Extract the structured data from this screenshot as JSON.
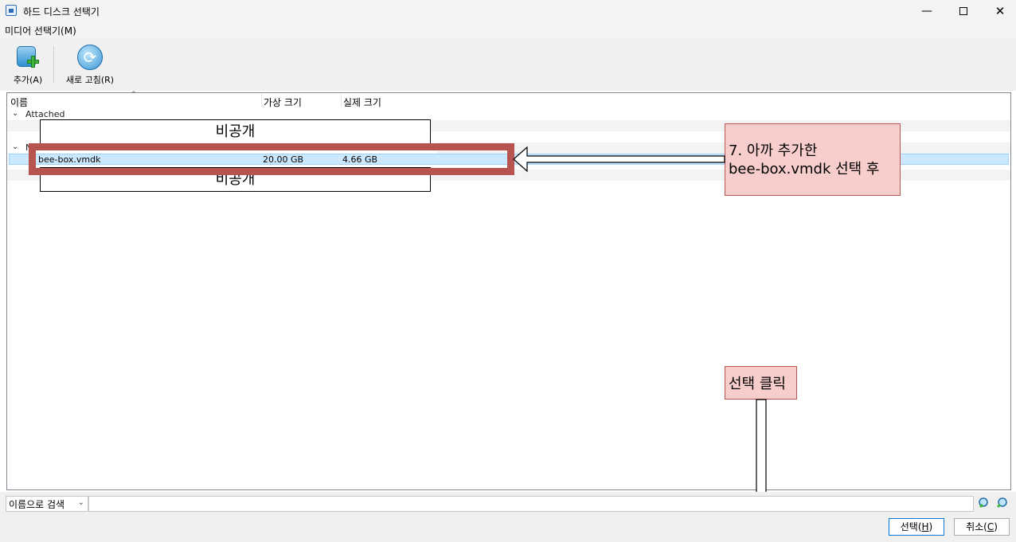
{
  "window": {
    "title": "하드 디스크 선택기",
    "controls": {
      "minimize": "—",
      "close": "✕"
    }
  },
  "menubar": {
    "media_menu": "미디어 선택기(M)"
  },
  "toolbar": {
    "add_label": "추가(A)",
    "refresh_label": "새로 고침(R)"
  },
  "list": {
    "columns": {
      "name": "이름",
      "virtual_size": "가상 크기",
      "actual_size": "실제 크기",
      "sort_indicator": "^"
    },
    "groups": [
      {
        "chevron": "⌄",
        "label": "Attached"
      },
      {
        "chevron": "⌄",
        "label": "N"
      }
    ],
    "rows": [
      {
        "name": "bee-box.vmdk",
        "virtual_size": "20.00 GB",
        "actual_size": "4.66 GB",
        "selected": true
      }
    ]
  },
  "redactions": {
    "top": "비공개",
    "bottom": "비공개"
  },
  "annotations": {
    "step7_line1": "7. 아까 추가한",
    "step7_line2": "bee-box.vmdk 선택 후",
    "click_hint": "선택 클릭",
    "highlight_color": "#b85450",
    "callout_fill": "#f8cecc"
  },
  "search": {
    "mode": "이름으로 검색",
    "mode_chevron": "⌄",
    "value": ""
  },
  "buttons": {
    "select_text": "선택(",
    "select_key": "H",
    "cancel_text": "취소(",
    "cancel_key": "C",
    "close_paren": ")"
  },
  "icons": {
    "app": "vbox-disk-icon",
    "add": "add-disk-icon",
    "refresh": "refresh-icon",
    "search_a": "search-icon",
    "search_b": "search-next-icon"
  }
}
